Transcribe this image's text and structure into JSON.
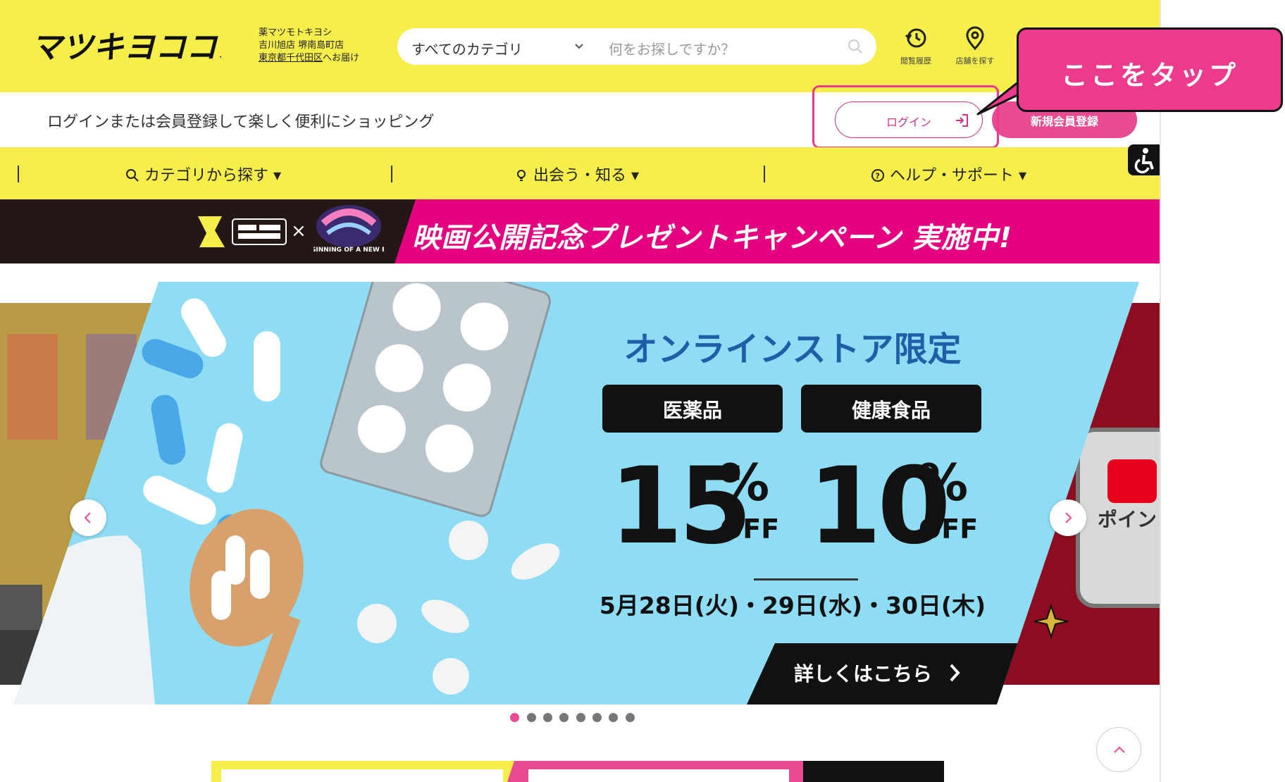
{
  "header": {
    "logo_text": "マツキヨココカラ",
    "delivery": {
      "line1": "薬マツモトキヨシ",
      "line2": "吉川旭店 堺南島町店",
      "line3_link": "東京都千代田区",
      "line3_rest": "へお届け"
    },
    "search": {
      "category": "すべてのカテゴリ",
      "placeholder": "何をお探しですか？"
    },
    "icons": [
      {
        "name": "history-icon",
        "label": "閲覧履歴"
      },
      {
        "name": "store-pin-icon",
        "label": "店舗を探す"
      }
    ]
  },
  "login_bar": {
    "message": "ログインまたは会員登録して楽しく便利にショッピング",
    "login_label": "ログイン",
    "register_label": "新規会員登録"
  },
  "nav": {
    "items": [
      {
        "label": "カテゴリから探す ▾",
        "icon": "search-icon"
      },
      {
        "label": "出会う・知る ▾",
        "icon": "bulb-icon"
      },
      {
        "label": "ヘルプ・サポート ▾",
        "icon": "help-icon"
      }
    ]
  },
  "promo_banner": {
    "text": "映画公開記念プレゼントキャンペーン 実施中!",
    "collab_x": "×",
    "collab_small": "BEGINNING OF A NEW ERA"
  },
  "carousel": {
    "title": "オンラインストア限定",
    "label_left": "医薬品",
    "label_right": "健康食品",
    "pct_left": "15",
    "pct_right": "10",
    "pct_sign": "%",
    "off": "OFF",
    "dates": "5月28日(火)・29日(水)・30日(木)",
    "cta": "詳しくはこちら",
    "right_slide_text": "ポイン",
    "active_index": 0,
    "dot_count": 8
  },
  "callout": {
    "text": "ここをタップ"
  },
  "colors": {
    "header_yellow": "#f6ee4a",
    "brand_pink": "#e94b93",
    "promo_pink": "#e4007f",
    "slide_blue": "#8fdcf5",
    "dark": "#111111"
  }
}
